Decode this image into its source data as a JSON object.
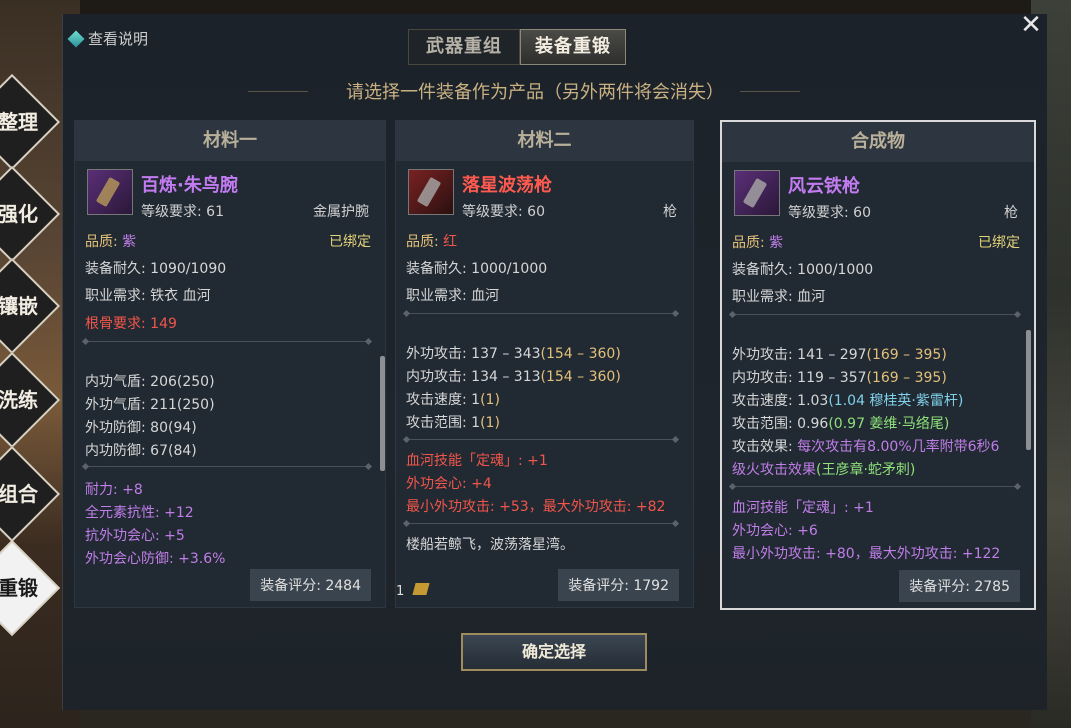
{
  "help": {
    "label": "查看说明"
  },
  "tabs": [
    {
      "label": "武器重组"
    },
    {
      "label": "装备重锻"
    }
  ],
  "instruction": "请选择一件装备作为产品（另外两件将会消失）",
  "side_menu": [
    {
      "label": "整理"
    },
    {
      "label": "强化"
    },
    {
      "label": "镶嵌"
    },
    {
      "label": "洗练"
    },
    {
      "label": "组合"
    },
    {
      "label": "重锻"
    }
  ],
  "cards": [
    {
      "header": "材料一",
      "name": "百炼·朱鸟腕",
      "level": "等级要求: 61",
      "type": "金属护腕",
      "quality_label": "品质:",
      "quality_value": "紫",
      "bound": "已绑定",
      "durability": "装备耐久: 1090/1090",
      "class_req": "职业需求: 铁衣 血河",
      "bone_req": "根骨要求: 149",
      "stats": [
        "内功气盾: 206(250)",
        "外功气盾: 211(250)",
        "外功防御: 80(94)",
        "内功防御: 67(84)"
      ],
      "bonuses": [
        "耐力: +8",
        "全元素抗性: +12",
        "抗外功会心: +5",
        "外功会心防御: +3.6%"
      ],
      "score": "装备评分: 2484"
    },
    {
      "header": "材料二",
      "name": "落星波荡枪",
      "level": "等级要求: 60",
      "type": "枪",
      "quality_label": "品质:",
      "quality_value": "红",
      "durability": "装备耐久: 1000/1000",
      "class_req": "职业需求: 血河",
      "stats": [
        {
          "label": "外功攻击: 137 – 343",
          "extra": "(154 – 360)"
        },
        {
          "label": "内功攻击: 134 – 313",
          "extra": "(154 – 360)"
        },
        {
          "label": "攻击速度: 1",
          "extra": "(1)"
        },
        {
          "label": "攻击范围: 1",
          "extra": "(1)"
        }
      ],
      "bonuses": [
        "血河技能「定魂」: +1",
        "外功会心: +4",
        "最小外功攻击: +53，最大外功攻击: +82"
      ],
      "flavor": "楼船若鲸飞，波荡落星湾。",
      "count": "1",
      "score": "装备评分: 1792"
    },
    {
      "header": "合成物",
      "name": "风云铁枪",
      "level": "等级要求: 60",
      "type": "枪",
      "quality_label": "品质:",
      "quality_value": "紫",
      "bound": "已绑定",
      "durability": "装备耐久: 1000/1000",
      "class_req": "职业需求: 血河",
      "stats": [
        {
          "label": "外功攻击: 141 – 297",
          "extra": "(169 – 395)"
        },
        {
          "label": "内功攻击: 119 – 357",
          "extra": "(169 – 395)"
        },
        {
          "label": "攻击速度: 1.03",
          "extra": "(1.04 穆桂英·紫雷杆)"
        },
        {
          "label": "攻击范围: 0.96",
          "extra": "(0.97 姜维·马络尾)"
        }
      ],
      "effect_label": "攻击效果:",
      "effect_text": "每次攻击有8.00%几率附带6秒6",
      "effect_text2": "级火攻击效果",
      "effect_source": "(王彦章·蛇矛刺)",
      "bonuses": [
        "血河技能「定魂」: +1",
        "外功会心: +6",
        "最小外功攻击: +80，最大外功攻击: +122"
      ],
      "score": "装备评分: 2785"
    }
  ],
  "confirm_label": "确定选择",
  "close_icon": "close-icon"
}
